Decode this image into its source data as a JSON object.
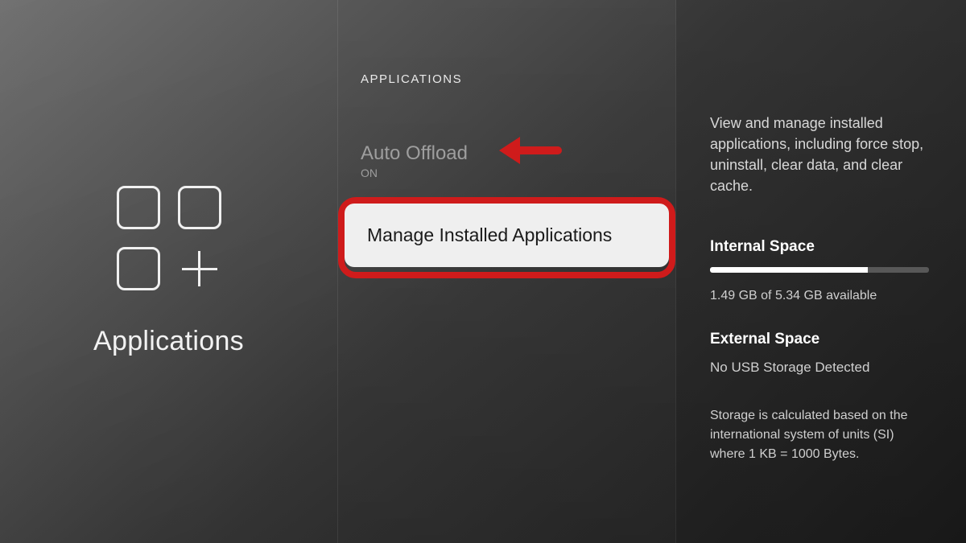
{
  "left": {
    "title": "Applications"
  },
  "mid": {
    "heading": "APPLICATIONS",
    "items": [
      {
        "label": "Auto Offload",
        "sub": "ON"
      },
      {
        "label": "Manage Installed Applications"
      }
    ]
  },
  "right": {
    "description": "View and manage installed applications, including force stop, uninstall, clear data, and clear cache.",
    "internal": {
      "title": "Internal Space",
      "used_pct": 72,
      "summary": "1.49 GB of 5.34 GB available"
    },
    "external": {
      "title": "External Space",
      "status": "No USB Storage Detected"
    },
    "footnote": "Storage is calculated based on the international system of units (SI) where 1 KB = 1000 Bytes."
  },
  "annotation": {
    "arrow_color": "#cf1b1b",
    "highlight_color": "#cf1b1b"
  }
}
